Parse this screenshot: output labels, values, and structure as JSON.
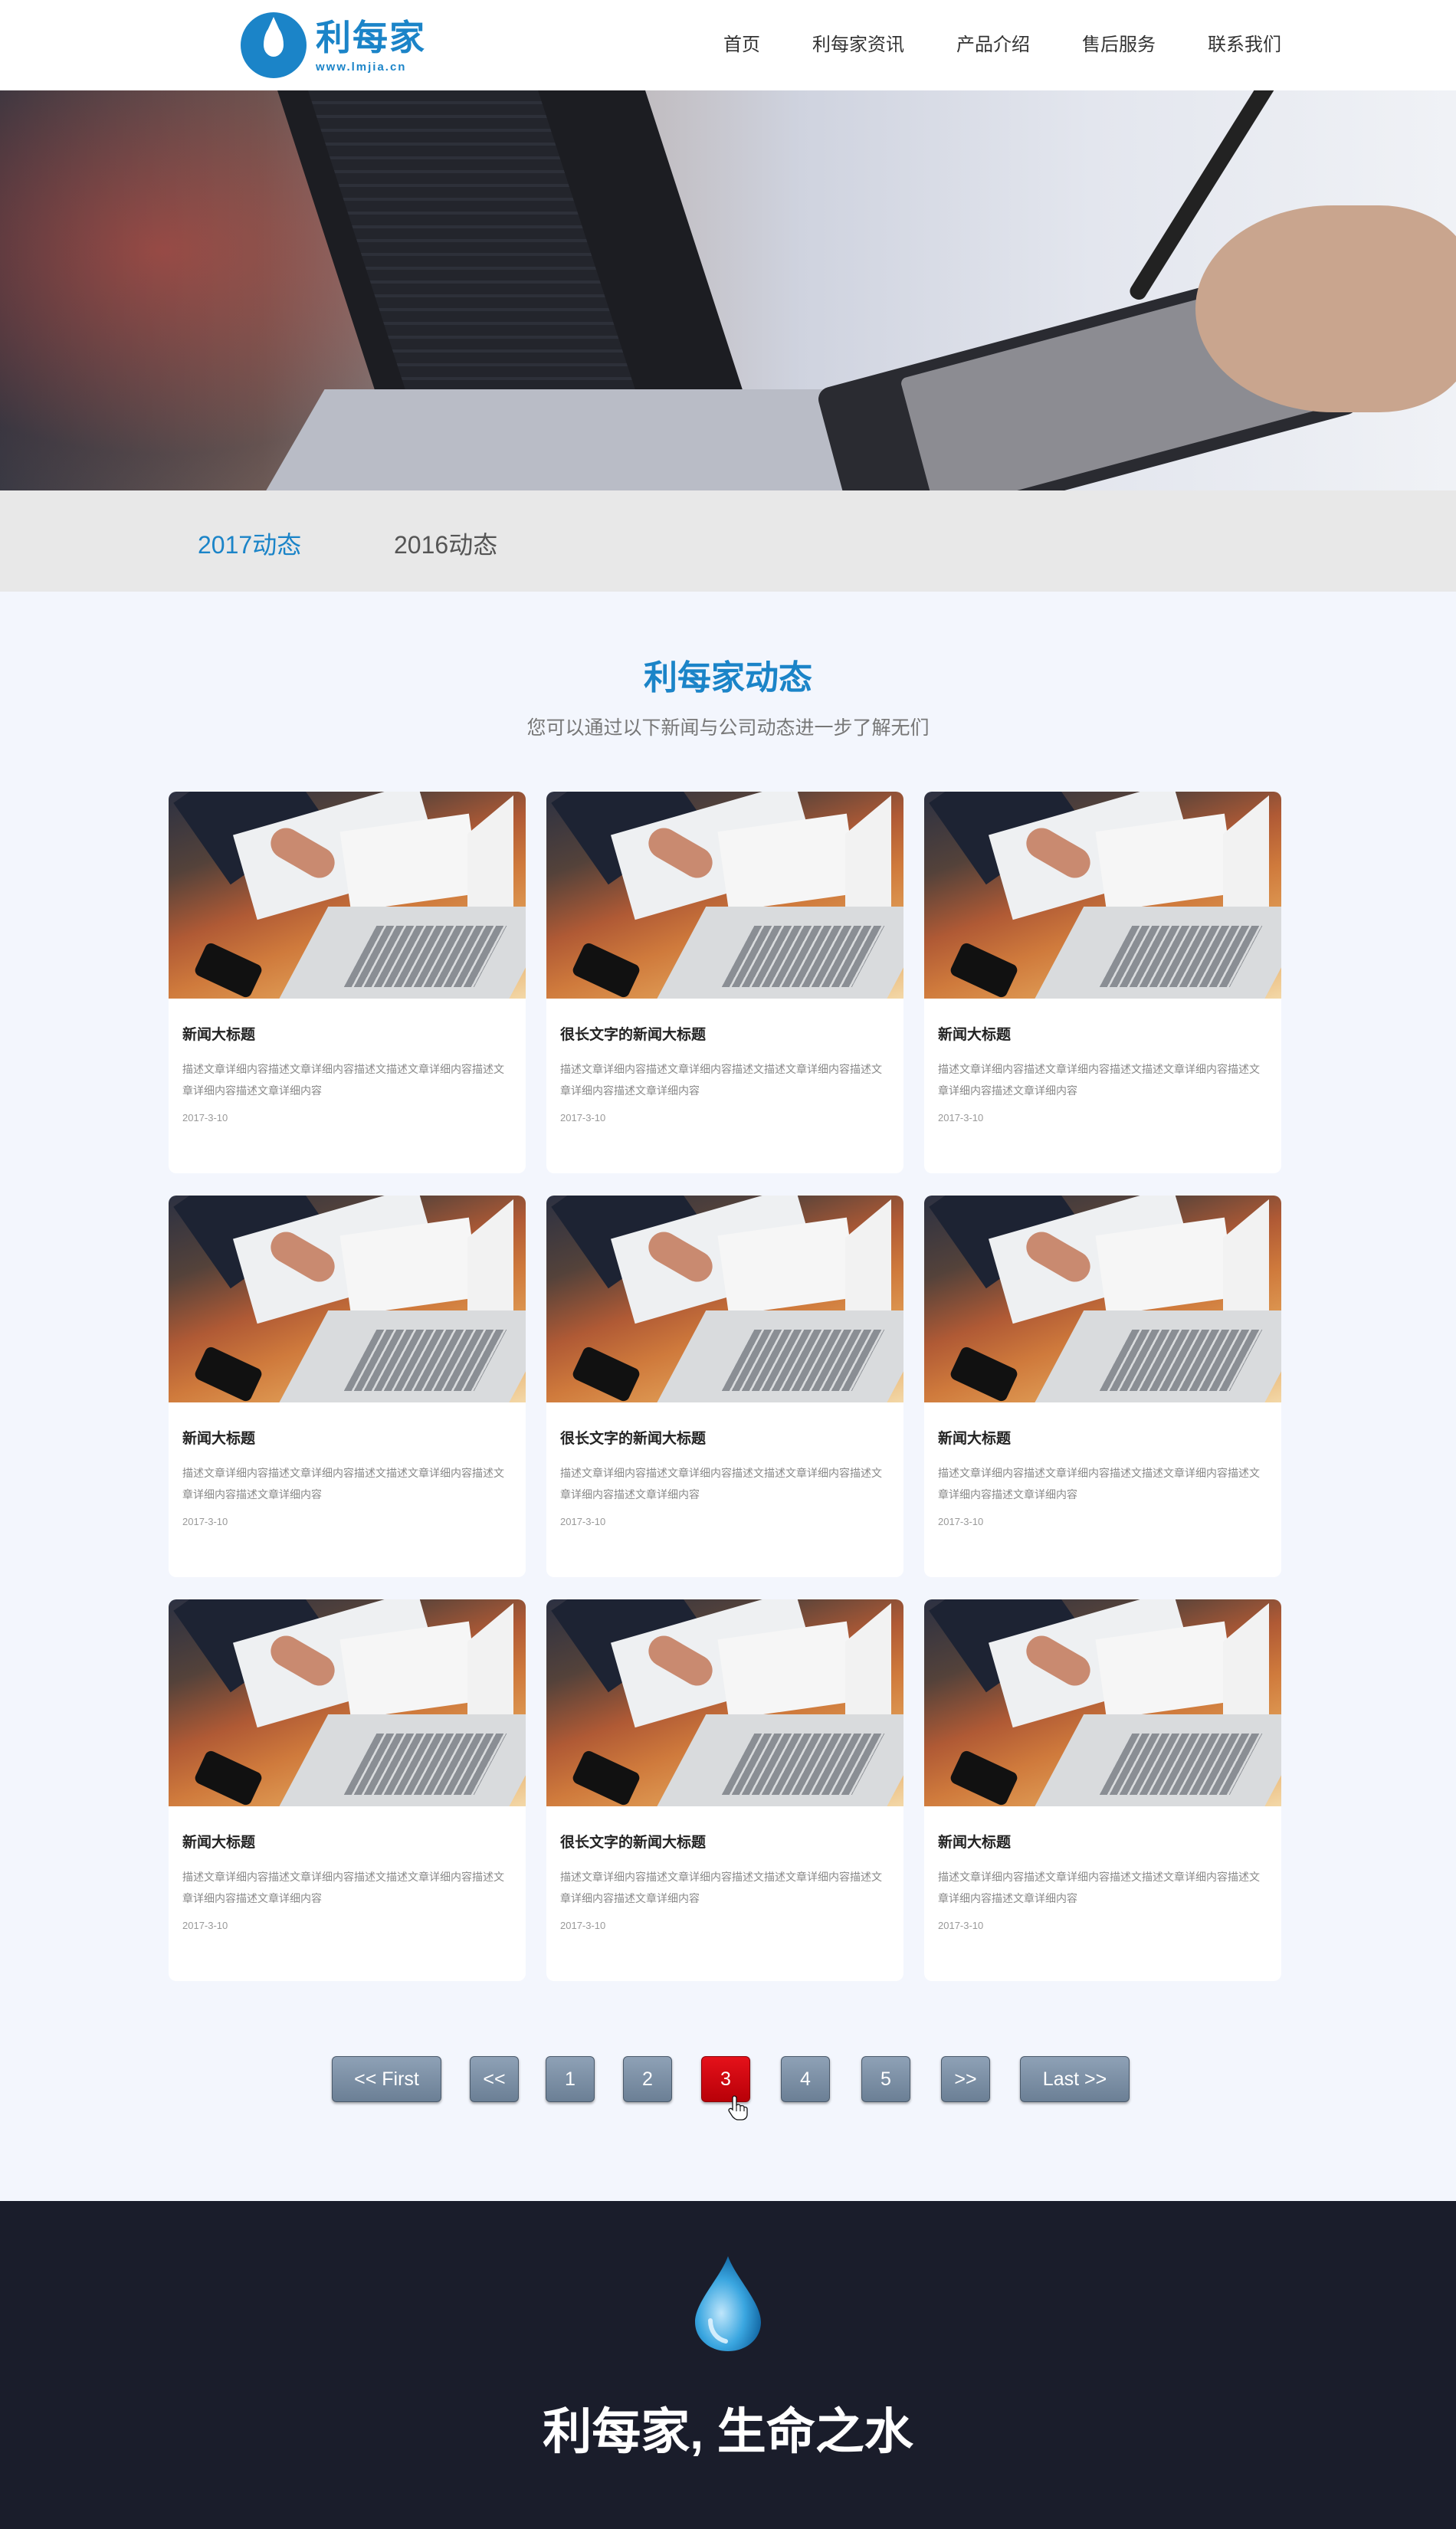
{
  "brand": {
    "name": "利每家",
    "url": "www.lmjia.cn",
    "color": "#1b84c8"
  },
  "nav": {
    "items": [
      "首页",
      "利每家资讯",
      "产品介绍",
      "售后服务",
      "联系我们"
    ]
  },
  "tabs": {
    "items": [
      "2017动态",
      "2016动态"
    ],
    "active": "2017动态"
  },
  "section": {
    "title": "利每家动态",
    "subtitle": "您可以通过以下新闻与公司动态进一步了解无们"
  },
  "cards": [
    {
      "title": "新闻大标题",
      "desc": "描述文章详细内容描述文章详细内容描述文描述文章详细内容描述文章详细内容描述文章详细内容",
      "date": "2017-3-10"
    },
    {
      "title": "很长文字的新闻大标题",
      "desc": "描述文章详细内容描述文章详细内容描述文描述文章详细内容描述文章详细内容描述文章详细内容",
      "date": "2017-3-10"
    },
    {
      "title": "新闻大标题",
      "desc": "描述文章详细内容描述文章详细内容描述文描述文章详细内容描述文章详细内容描述文章详细内容",
      "date": "2017-3-10"
    },
    {
      "title": "新闻大标题",
      "desc": "描述文章详细内容描述文章详细内容描述文描述文章详细内容描述文章详细内容描述文章详细内容",
      "date": "2017-3-10"
    },
    {
      "title": "很长文字的新闻大标题",
      "desc": "描述文章详细内容描述文章详细内容描述文描述文章详细内容描述文章详细内容描述文章详细内容",
      "date": "2017-3-10"
    },
    {
      "title": "新闻大标题",
      "desc": "描述文章详细内容描述文章详细内容描述文描述文章详细内容描述文章详细内容描述文章详细内容",
      "date": "2017-3-10"
    },
    {
      "title": "新闻大标题",
      "desc": "描述文章详细内容描述文章详细内容描述文描述文章详细内容描述文章详细内容描述文章详细内容",
      "date": "2017-3-10"
    },
    {
      "title": "很长文字的新闻大标题",
      "desc": "描述文章详细内容描述文章详细内容描述文描述文章详细内容描述文章详细内容描述文章详细内容",
      "date": "2017-3-10"
    },
    {
      "title": "新闻大标题",
      "desc": "描述文章详细内容描述文章详细内容描述文描述文章详细内容描述文章详细内容描述文章详细内容",
      "date": "2017-3-10"
    }
  ],
  "pagination": {
    "first": "<< First",
    "prev": "<<",
    "pages": [
      "1",
      "2",
      "3",
      "4",
      "5"
    ],
    "active": "3",
    "next": ">>",
    "last": "Last >>",
    "active_color": "#e5111a"
  },
  "footer": {
    "slogan": "利每家, 生命之水",
    "background": "#1a1d2b"
  },
  "icons": {
    "logo": "water-drop-logo-icon",
    "footer": "water-drop-icon",
    "cursor": "hand-pointer-icon"
  }
}
